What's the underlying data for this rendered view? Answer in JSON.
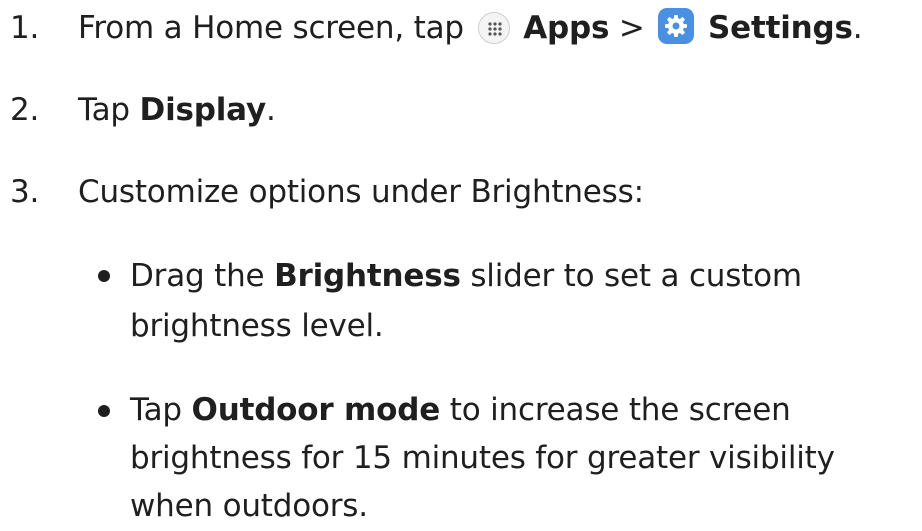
{
  "steps": [
    {
      "number": "1.",
      "prefix": "From a Home screen, tap",
      "apps_label": "Apps",
      "separator": ">",
      "settings_label": "Settings",
      "suffix": "."
    },
    {
      "number": "2.",
      "prefix": "Tap",
      "bold": "Display",
      "suffix": "."
    },
    {
      "number": "3.",
      "text": "Customize options under Brightness:"
    }
  ],
  "bullets": [
    {
      "line1_prefix": "Drag the",
      "line1_bold": "Brightness",
      "line1_suffix": "slider to set a custom",
      "line2": "brightness level."
    },
    {
      "line1_prefix": "Tap",
      "line1_bold": "Outdoor mode",
      "line1_suffix": "to increase the screen",
      "line2": "brightness for 15 minutes for greater visibility",
      "line3": "when outdoors."
    }
  ],
  "icons": {
    "apps": "apps-grid-icon",
    "settings": "settings-gear-icon",
    "settings_color": "#4a90e2"
  }
}
